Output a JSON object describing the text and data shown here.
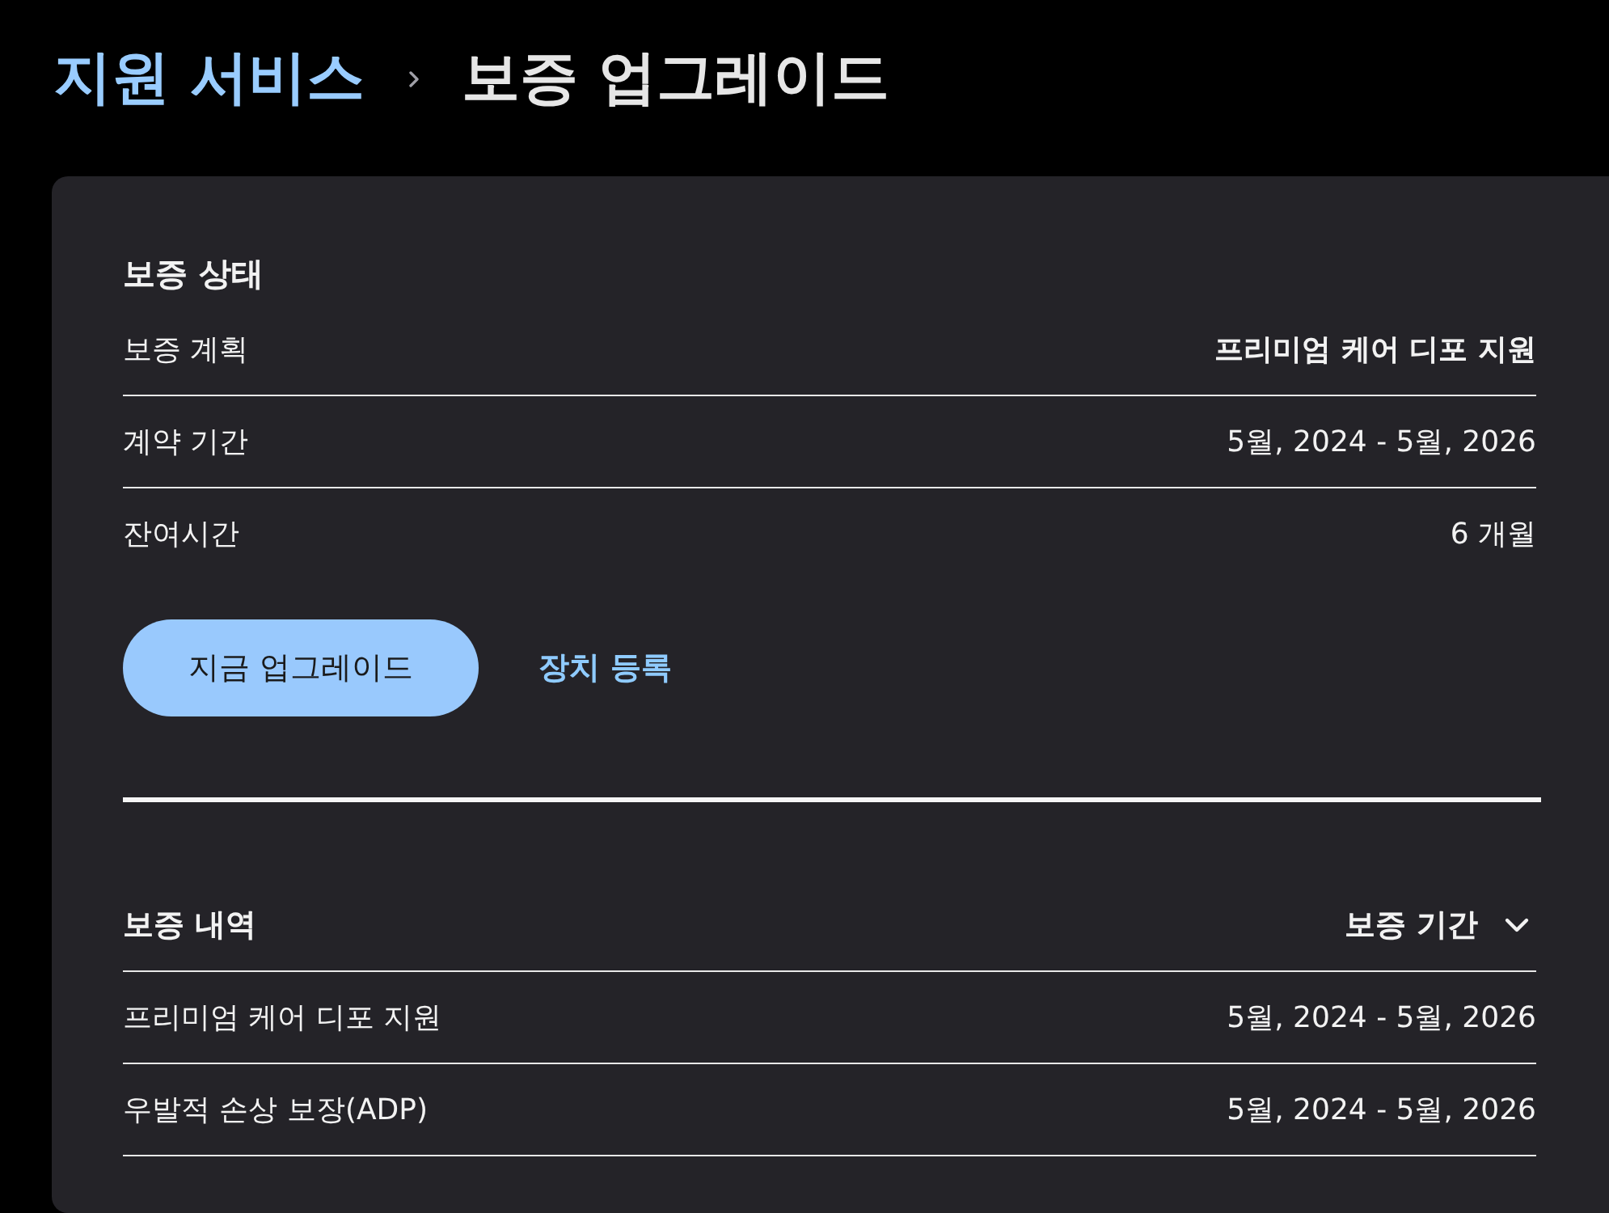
{
  "breadcrumb": [
    {
      "label": "지원 서비스",
      "kind": "link"
    },
    {
      "label": "보증 업그레이드",
      "kind": "current"
    }
  ],
  "status": {
    "title": "보증 상태",
    "rows": [
      {
        "label": "보증 계획",
        "value": "프리미엄 케어 디포 지원",
        "emphasized": true
      },
      {
        "label": "계약 기간",
        "value": "5월, 2024 - 5월, 2026",
        "emphasized": false
      },
      {
        "label": "잔여시간",
        "value": "6 개월",
        "emphasized": false
      }
    ]
  },
  "actions": {
    "primary_button": "지금 업그레이드",
    "link": "장치 등록"
  },
  "history": {
    "columns": [
      "보증 내역",
      "보증 기간"
    ],
    "rows": [
      {
        "plan": "프리미엄 케어 디포 지원",
        "period": "5월, 2024 - 5월, 2026"
      },
      {
        "plan": "우발적 손상 보장(ADP)",
        "period": "5월, 2024 - 5월, 2026"
      }
    ]
  }
}
